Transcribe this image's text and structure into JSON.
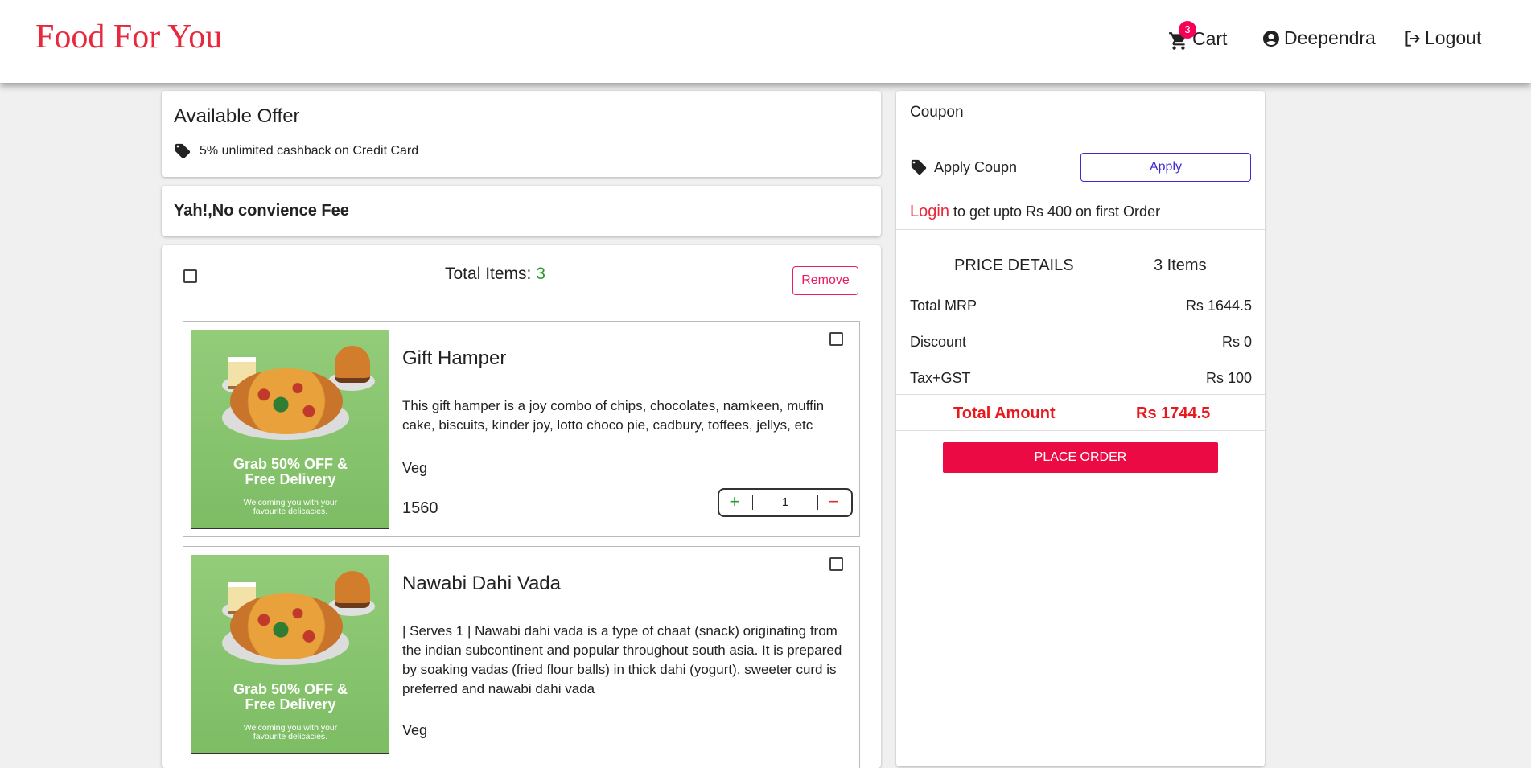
{
  "header": {
    "brand": "Food For You",
    "cart_label": "Cart",
    "cart_count": "3",
    "user_name": "Deependra",
    "logout_label": "Logout"
  },
  "offer": {
    "title": "Available Offer",
    "text": "5% unlimited cashback on Credit Card"
  },
  "fee": {
    "text": "Yah!,No convience Fee"
  },
  "items_header": {
    "total_label": "Total Items: ",
    "total_count": "3",
    "remove_label": "Remove"
  },
  "promo": {
    "title_line1": "Grab 50% OFF &",
    "title_line2": "Free Delivery",
    "sub_line1": "Welcoming you with your",
    "sub_line2": "favourite delicacies."
  },
  "items": [
    {
      "title": "Gift Hamper",
      "description": "This gift hamper is a joy combo of chips, chocolates, namkeen, muffin cake, biscuits, kinder joy, lotto choco pie, cadbury, toffees, jellys, etc",
      "type": "Veg",
      "price": "1560",
      "quantity": "1",
      "plus": "+",
      "minus": "−"
    },
    {
      "title": "Nawabi Dahi Vada",
      "description": "| Serves 1 | Nawabi dahi vada is a type of chaat (snack) originating from the indian subcontinent and popular throughout south asia. It is prepared by soaking vadas (fried flour balls) in thick dahi (yogurt). sweeter curd is preferred and nawabi dahi vada",
      "type": "Veg"
    }
  ],
  "coupon": {
    "title": "Coupon",
    "apply_label": "Apply Coupn",
    "apply_button": "Apply",
    "login_link": "Login",
    "login_text": " to get upto Rs 400 on first Order"
  },
  "price_details": {
    "title": "PRICE DETAILS",
    "items_count": "3 Items",
    "rows": [
      {
        "label": "Total MRP",
        "value": "Rs 1644.5"
      },
      {
        "label": "Discount",
        "value": "Rs 0"
      },
      {
        "label": "Tax+GST",
        "value": "Rs 100"
      }
    ],
    "total_label": "Total Amount",
    "total_value": "Rs 1744.5",
    "place_order": "PLACE ORDER"
  },
  "colors": {
    "brand": "#e8283c",
    "accent_pink": "#eb0a44",
    "badge": "#f50057",
    "apply_blue": "#3d2bd1",
    "green": "#2e9b2e"
  },
  "icons": [
    "cart-icon",
    "account-circle-icon",
    "logout-icon",
    "tag-icon"
  ]
}
